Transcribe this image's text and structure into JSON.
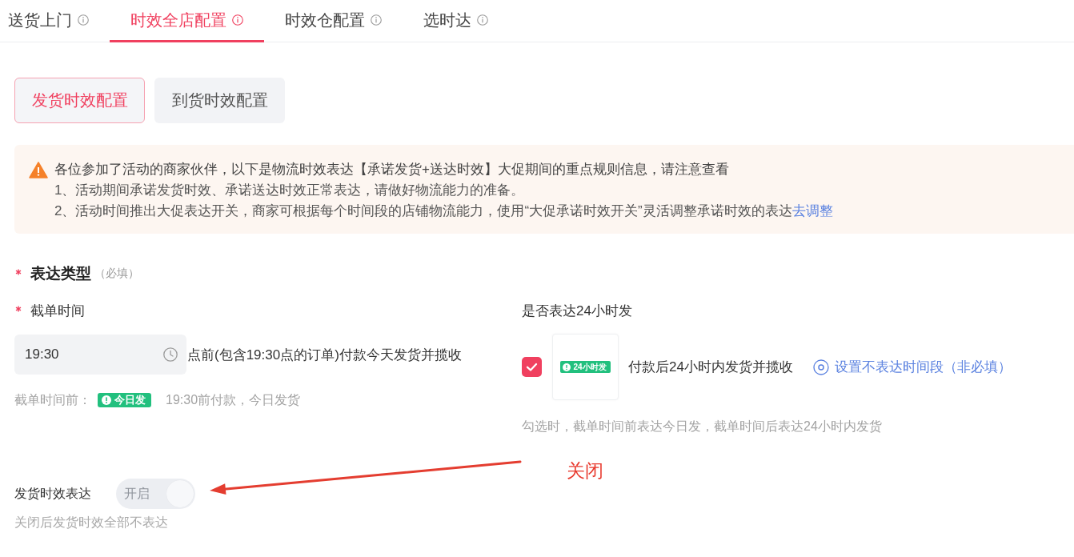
{
  "tabs": [
    {
      "label": "送货上门",
      "selected": false
    },
    {
      "label": "时效全店配置",
      "selected": true
    },
    {
      "label": "时效仓配置",
      "selected": false
    },
    {
      "label": "选时达",
      "selected": false
    }
  ],
  "sub_tabs": [
    {
      "label": "发货时效配置",
      "selected": true
    },
    {
      "label": "到货时效配置",
      "selected": false
    }
  ],
  "notice": {
    "title": "各位参加了活动的商家伙伴，以下是物流时效表达【承诺发货+送达时效】大促期间的重点规则信息，请注意查看",
    "items": [
      {
        "text": "1、活动期间承诺发货时效、承诺送达时效正常表达，请做好物流能力的准备。"
      },
      {
        "text": "2、活动时间推出大促表达开关，商家可根据每个时间段的店铺物流能力，使用“大促承诺时效开关”灵活调整承诺时效的表达",
        "link": "去调整"
      }
    ]
  },
  "expression_type": {
    "label": "表达类型",
    "required": true,
    "note": "（必填）"
  },
  "cutoff": {
    "label": "截单时间",
    "required": true,
    "value": "19:30",
    "suffix": "点前(包含19:30点的订单)付款今天发货并揽收",
    "hint_label": "截单时间前：",
    "badge": "今日发",
    "hint": "19:30前付款，今日发货"
  },
  "hour24": {
    "label": "是否表达24小时发",
    "checked": true,
    "badge": "24小时发",
    "text": "付款后24小时内发货并揽收",
    "link": "设置不表达时间段（非必填）",
    "hint": "勾选时，截单时间前表达今日发，截单时间后表达24小时内发货"
  },
  "shipping_expression": {
    "label": "发货时效表达",
    "switch": {
      "label": "开启",
      "on": true,
      "disabled": true
    },
    "hint": "关闭后发货时效全部不表达"
  },
  "annotation": {
    "text": "关闭"
  }
}
